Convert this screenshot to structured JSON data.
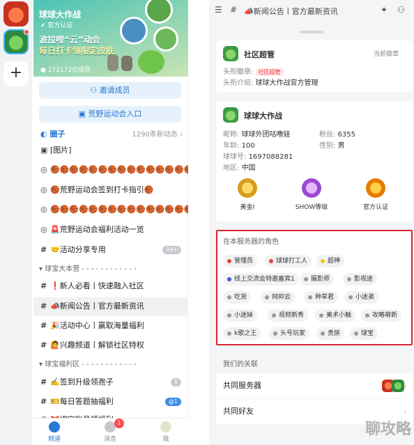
{
  "rail": {
    "add_label": "+"
  },
  "guild": {
    "name": "球球大作战",
    "official_tag": "官方认证",
    "promo_line1": "波拉哩“云”动会",
    "promo_line2": "每日打卡领限定皮肤",
    "members": "272172位成员",
    "invite_label": "邀请成员",
    "event_entry_label": "荒野运动会入口",
    "circle_label": "圈子",
    "circle_meta": "1290条新动态"
  },
  "channels": [
    {
      "hash": "▣",
      "label": "[图片]"
    },
    {
      "hash": "◎",
      "label": "🏀🏀🏀🏀🏀🏀🏀🏀🏀🏀🏀🏀🏀🏀🏀"
    },
    {
      "hash": "◎",
      "label": "🏀荒野运动会签到打卡指引🏀"
    },
    {
      "hash": "◎",
      "label": "🏀🏀🏀🏀🏀🏀🏀🏀🏀🏀🏀🏀🏀🏀🏀"
    },
    {
      "hash": "◎",
      "label": "🚨荒野运动会福利活动一览"
    },
    {
      "hash": "#",
      "label": "🤝活动分享专用",
      "pill": "99+"
    }
  ],
  "group1": {
    "title": "球宝大本营 - - - - - - - - - - - -",
    "items": [
      {
        "label": "❗新人必看丨快速融入社区"
      },
      {
        "label": "📣新闻公告丨官方最新资讯"
      },
      {
        "label": "🎉活动中心丨赢取海量福利"
      },
      {
        "label": "🙋兴趣频道丨解锁社区特权"
      }
    ]
  },
  "group2": {
    "title": "球宝福利区 - - - - - - - - - - - -",
    "items": [
      {
        "label": "✍️签到升级领孢子",
        "pill": "1"
      },
      {
        "label": "🎫每日答题抽福利",
        "pill": "@1"
      },
      {
        "label": "🎀绑定账号领福利"
      }
    ]
  },
  "bottom_tabs": [
    {
      "label": "频道",
      "active": true
    },
    {
      "label": "消息",
      "badge": "1"
    },
    {
      "label": "我"
    }
  ],
  "channel_header": {
    "title": "📣新闻公告丨官方最新资讯"
  },
  "admin_card": {
    "name": "社区超管",
    "right_label": "当前徽章",
    "badge_key": "头衔徽章:",
    "badge_value": "社区超管",
    "desc_key": "头衔介绍:",
    "desc_value": "球球大作战官方管理"
  },
  "profile_card": {
    "name": "球球大作战",
    "nickname_key": "昵称:",
    "nickname": "球球外团咕噜娃",
    "fans_key": "粉丝:",
    "fans": "6355",
    "age_key": "年龄:",
    "age": "100",
    "gender_key": "性别:",
    "gender": "男",
    "id_key": "球球号:",
    "id": "1697088281",
    "region_key": "地区:",
    "region": "中国",
    "medals": [
      {
        "label": "美金I",
        "color": "#e8b43a"
      },
      {
        "label": "SHOW等级",
        "color": "#b46be8"
      },
      {
        "label": "官方认证",
        "color": "#f0a020"
      }
    ]
  },
  "roles": {
    "title": "在本服务器的角色",
    "chips": [
      {
        "label": "管理员",
        "dot": "#e8413c"
      },
      {
        "label": "球球打工人",
        "dot": "#e8413c"
      },
      {
        "label": "超神",
        "dot": "#f5c518"
      },
      {
        "label": "线上交流会特邀嘉宾1",
        "dot": "#3b5bd6"
      },
      {
        "label": "摄影师",
        "dot": "#999999"
      },
      {
        "label": "影视迷",
        "dot": "#999999"
      },
      {
        "label": "吃货",
        "dot": "#999999"
      },
      {
        "label": "网抑云",
        "dot": "#999999"
      },
      {
        "label": "种草君",
        "dot": "#999999"
      },
      {
        "label": "小迷弟",
        "dot": "#999999"
      },
      {
        "label": "小迷妹",
        "dot": "#999999"
      },
      {
        "label": "视频新秀",
        "dot": "#999999"
      },
      {
        "label": "美术小触",
        "dot": "#999999"
      },
      {
        "label": "攻略萌新",
        "dot": "#999999"
      },
      {
        "label": "k歌之王",
        "dot": "#999999"
      },
      {
        "label": "头号玩家",
        "dot": "#999999"
      },
      {
        "label": "贵族",
        "dot": "#999999"
      },
      {
        "label": "球宝",
        "dot": "#999999"
      }
    ]
  },
  "relations": {
    "title": "我们的关联",
    "common_servers": "共同服务器",
    "common_friends": "共同好友"
  },
  "watermark": "聊攻略"
}
